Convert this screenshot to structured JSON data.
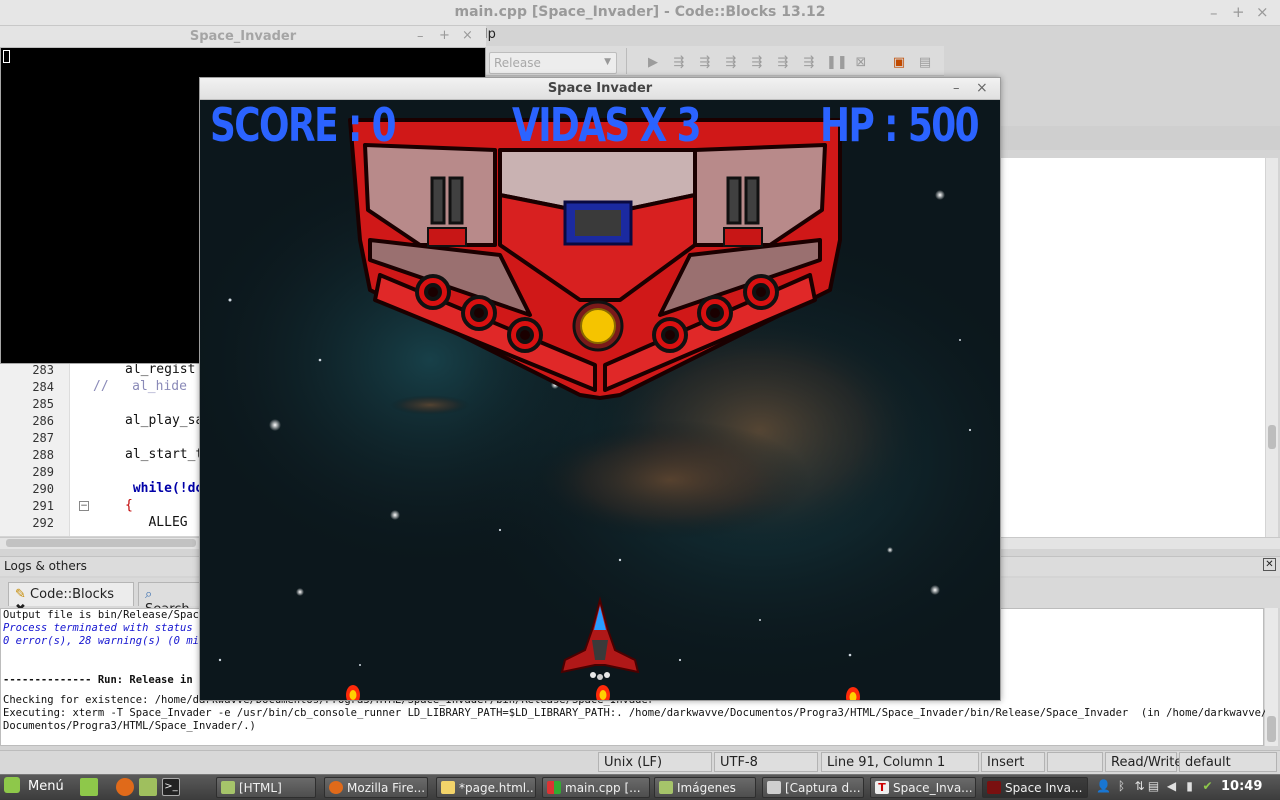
{
  "codeblocks": {
    "title": "main.cpp [Space_Invader] - Code::Blocks 13.12",
    "menu_fragment": "lp",
    "build_target": "Release",
    "code_lines": [
      {
        "no": "283",
        "text": "al_regist"
      },
      {
        "no": "284",
        "text": "//   al_hide"
      },
      {
        "no": "285",
        "text": ""
      },
      {
        "no": "286",
        "text": "al_play_sa"
      },
      {
        "no": "287",
        "text": ""
      },
      {
        "no": "288",
        "text": "al_start_t"
      },
      {
        "no": "289",
        "text": ""
      },
      {
        "no": "290",
        "text": " while(!do"
      },
      {
        "no": "291",
        "text": "{"
      },
      {
        "no": "292",
        "text": "   ALLEG"
      }
    ],
    "logs": {
      "title": "Logs & others",
      "tabs": [
        "Code::Blocks",
        "Search"
      ],
      "lines": [
        "Output file is bin/Release/Space",
        "Process terminated with status 0",
        "0 error(s), 28 warning(s) (0 minu",
        "",
        "",
        "-------------- Run: Release in Sp",
        "",
        "Checking for existence: /home/darkwavve/Documentos/Progra3/HTML/Space_Invader/bin/Release/Space_Invader",
        "Executing: xterm -T Space_Invader -e /usr/bin/cb_console_runner LD_LIBRARY_PATH=$LD_LIBRARY_PATH:. /home/darkwavve/Documentos/Progra3/HTML/Space_Invader/bin/Release/Space_Invader  (in /home/darkwavve/",
        "Documentos/Progra3/HTML/Space_Invader/.)"
      ]
    },
    "status": {
      "eol": "Unix (LF)",
      "encoding": "UTF-8",
      "position": "Line 91, Column 1",
      "mode": "Insert",
      "access": "Read/Write",
      "lang": "default"
    }
  },
  "console": {
    "title": "Space_Invader"
  },
  "game": {
    "title": "Space Invader",
    "score_label": "SCORE : 0",
    "lives_label": "VIDAS X 3",
    "hp_label": "HP : 500",
    "hud_color": "#2b63ff"
  },
  "taskbar": {
    "menu_label": "Menú",
    "tasks": [
      "[HTML]",
      "Mozilla Fire...",
      "*page.html...",
      "main.cpp [...",
      "Imágenes",
      "[Captura d...",
      "Space_Inva...",
      "Space Inva..."
    ],
    "clock": "10:49"
  }
}
